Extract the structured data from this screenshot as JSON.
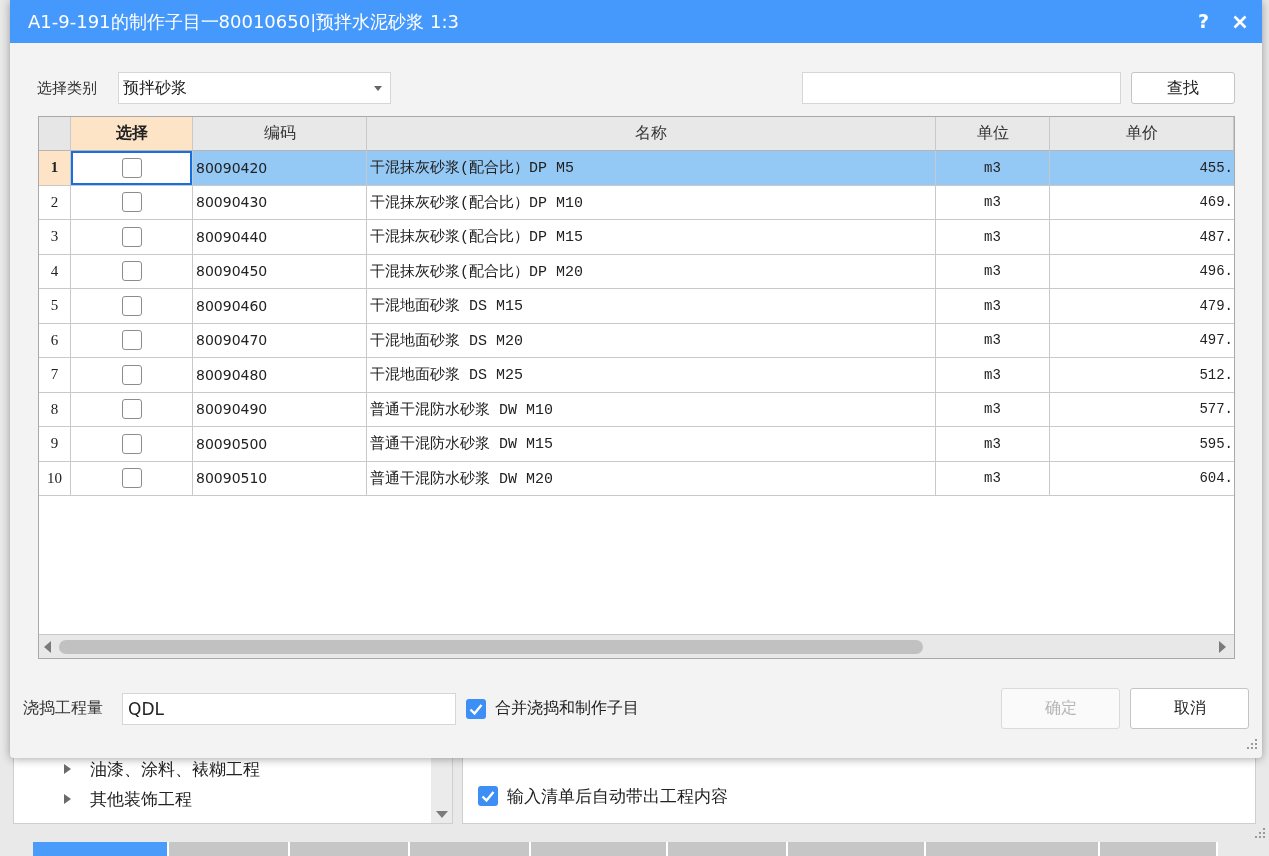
{
  "window": {
    "title": "A1-9-191的制作子目一80010650|预拌水泥砂浆 1:3",
    "help": "?"
  },
  "filter": {
    "label": "选择类别",
    "category": "预拌砂浆",
    "search_button": "查找"
  },
  "table": {
    "columns": [
      {
        "label": "选择",
        "kind": "check",
        "selected": true
      },
      {
        "label": "编码",
        "kind": "code",
        "selected": false
      },
      {
        "label": "名称",
        "kind": "name",
        "selected": false
      },
      {
        "label": "单位",
        "kind": "unit",
        "selected": false
      },
      {
        "label": "单价",
        "kind": "price",
        "selected": false
      }
    ],
    "rows": [
      {
        "number": "1",
        "selected": true,
        "checked": false,
        "code": "80090420",
        "name": "干混抹灰砂浆(配合比）DP M5",
        "unit": "m3",
        "price": "455."
      },
      {
        "number": "2",
        "selected": false,
        "checked": false,
        "code": "80090430",
        "name": "干混抹灰砂浆(配合比）DP M10",
        "unit": "m3",
        "price": "469."
      },
      {
        "number": "3",
        "selected": false,
        "checked": false,
        "code": "80090440",
        "name": "干混抹灰砂浆(配合比）DP M15",
        "unit": "m3",
        "price": "487."
      },
      {
        "number": "4",
        "selected": false,
        "checked": false,
        "code": "80090450",
        "name": "干混抹灰砂浆(配合比）DP M20",
        "unit": "m3",
        "price": "496."
      },
      {
        "number": "5",
        "selected": false,
        "checked": false,
        "code": "80090460",
        "name": "干混地面砂浆 DS M15",
        "unit": "m3",
        "price": "479."
      },
      {
        "number": "6",
        "selected": false,
        "checked": false,
        "code": "80090470",
        "name": "干混地面砂浆 DS M20",
        "unit": "m3",
        "price": "497."
      },
      {
        "number": "7",
        "selected": false,
        "checked": false,
        "code": "80090480",
        "name": "干混地面砂浆 DS M25",
        "unit": "m3",
        "price": "512."
      },
      {
        "number": "8",
        "selected": false,
        "checked": false,
        "code": "80090490",
        "name": "普通干混防水砂浆 DW M10",
        "unit": "m3",
        "price": "577."
      },
      {
        "number": "9",
        "selected": false,
        "checked": false,
        "code": "80090500",
        "name": "普通干混防水砂浆 DW M15",
        "unit": "m3",
        "price": "595."
      },
      {
        "number": "10",
        "selected": false,
        "checked": false,
        "code": "80090510",
        "name": "普通干混防水砂浆 DW M20",
        "unit": "m3",
        "price": "604."
      }
    ]
  },
  "quantity": {
    "label": "浇捣工程量",
    "value": "QDL"
  },
  "merge": {
    "label": "合并浇捣和制作子目",
    "checked": true
  },
  "buttons": [
    {
      "label": "确定",
      "disabled": true
    },
    {
      "label": "取消",
      "disabled": false
    }
  ],
  "background": {
    "tree": [
      {
        "label": "油漆、涂料、裱糊工程",
        "expanded": false
      },
      {
        "label": "其他装饰工程",
        "expanded": false
      }
    ],
    "option": {
      "label": "输入清单后自动带出工程内容",
      "checked": true
    },
    "tabs": [
      {
        "selected": true
      },
      {
        "selected": false
      },
      {
        "selected": false
      },
      {
        "selected": false
      },
      {
        "selected": false
      },
      {
        "selected": false
      },
      {
        "selected": false
      },
      {
        "selected": false
      },
      {
        "selected": false
      }
    ]
  }
}
